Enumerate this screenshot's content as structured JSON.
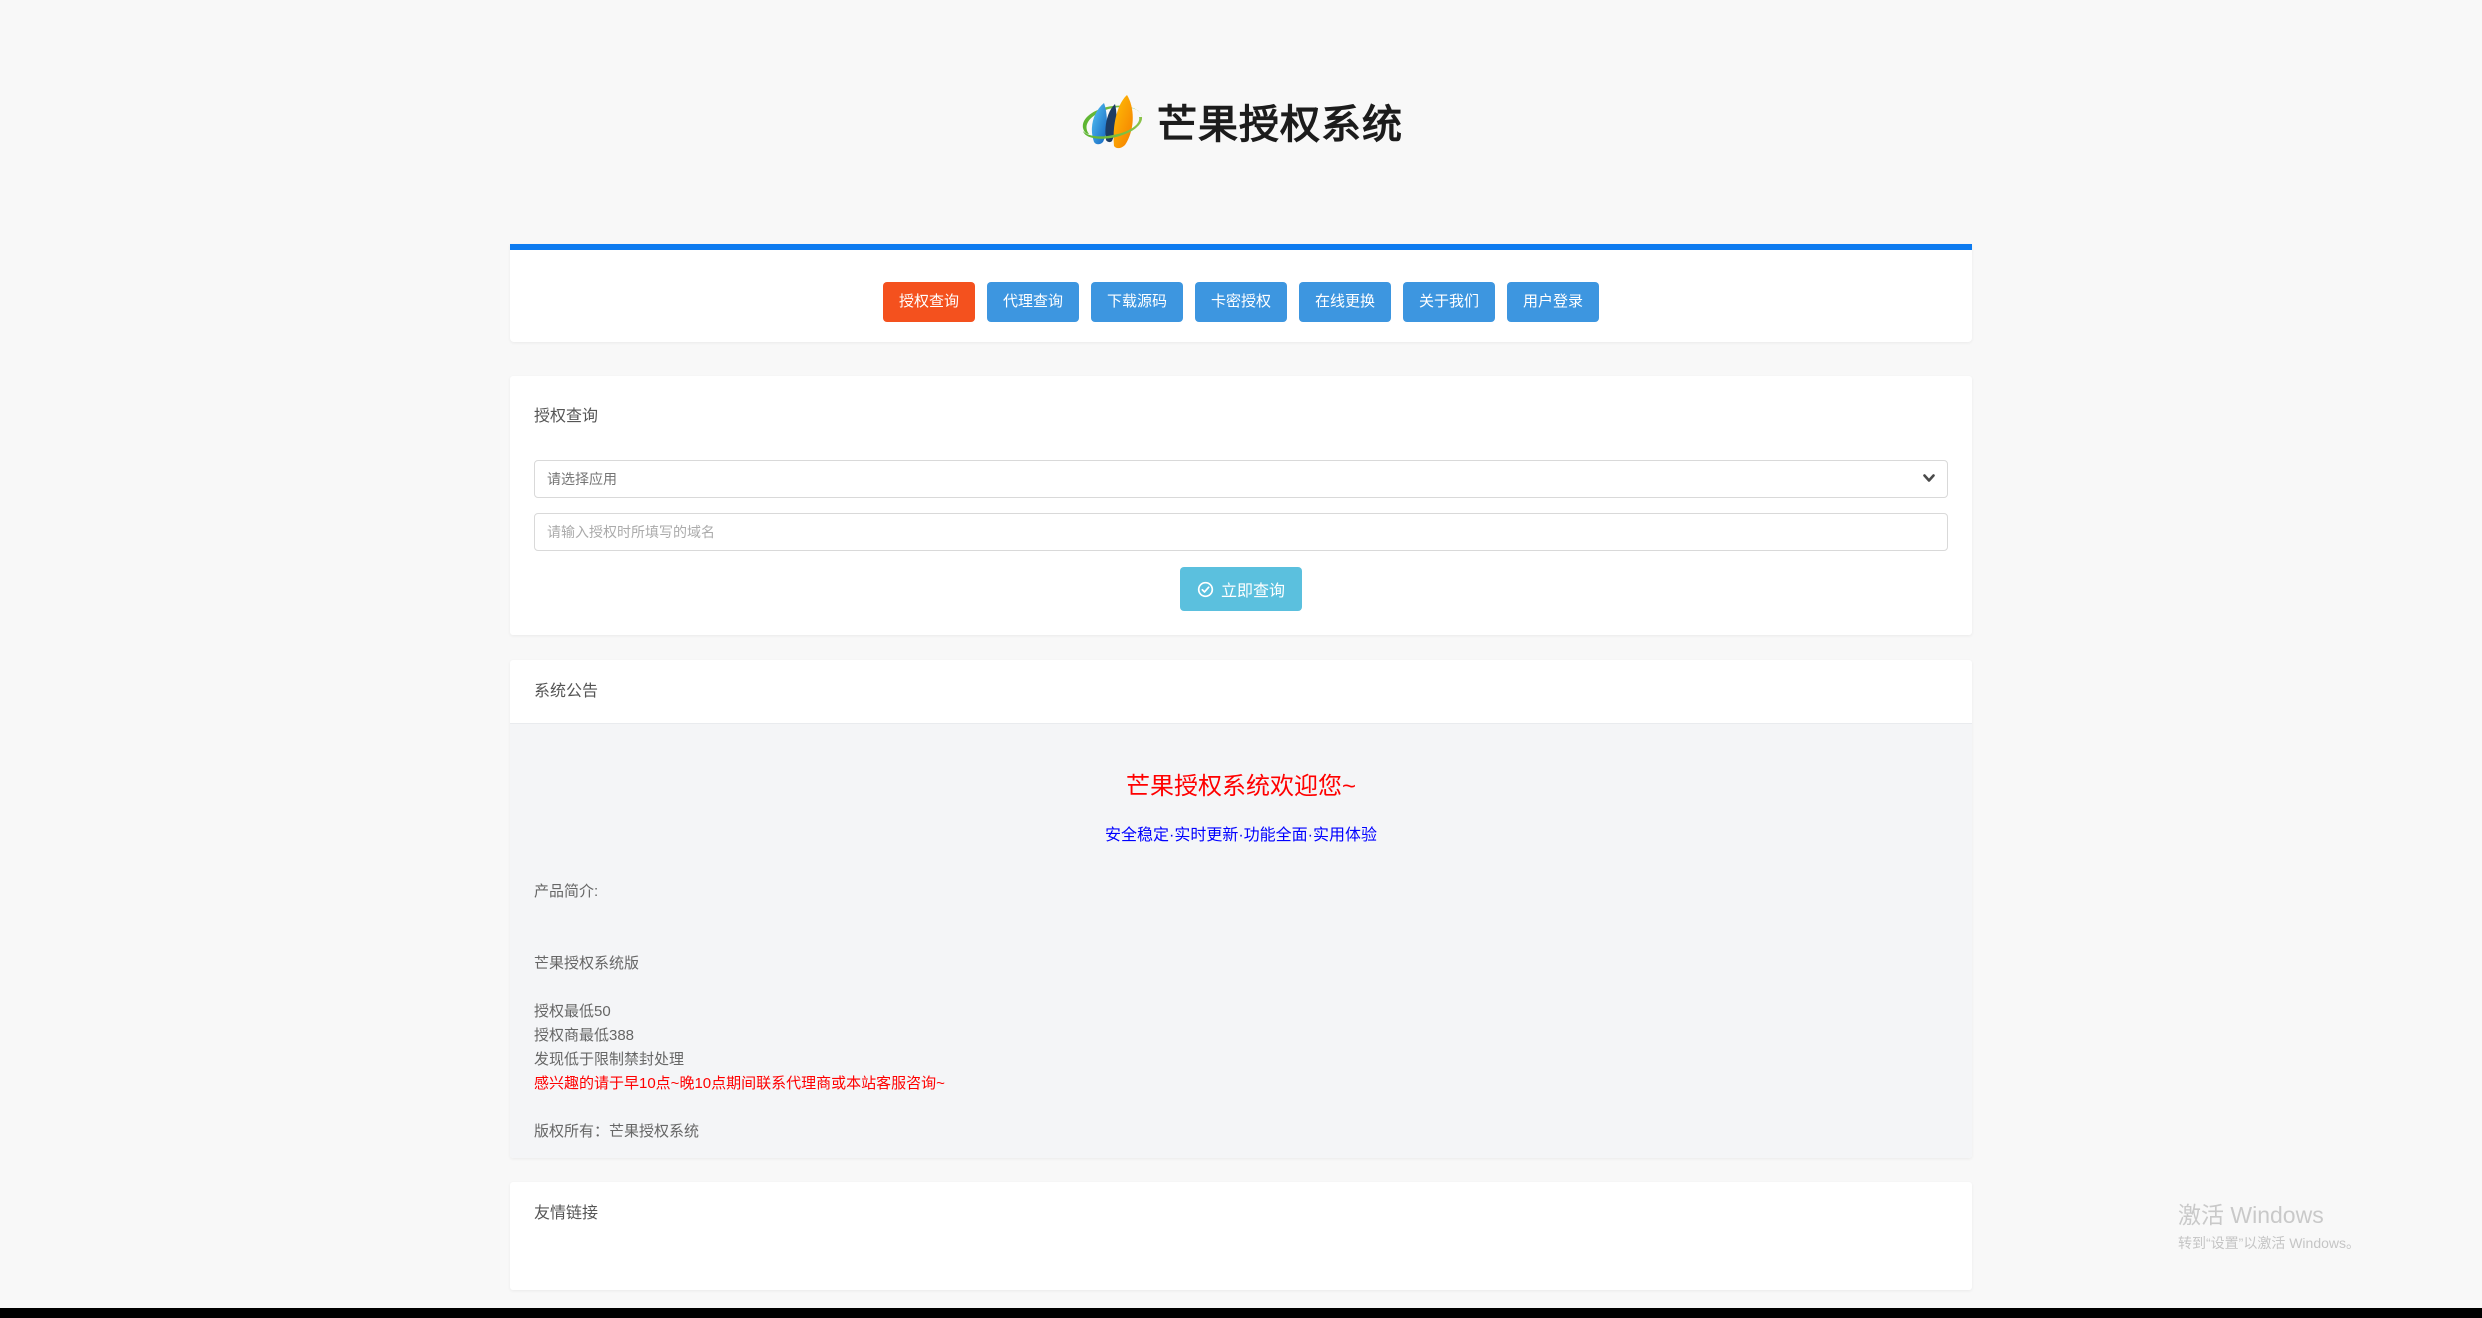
{
  "site": {
    "title": "芒果授权系统"
  },
  "nav": {
    "items": [
      {
        "label": "授权查询",
        "active": true
      },
      {
        "label": "代理查询",
        "active": false
      },
      {
        "label": "下载源码",
        "active": false
      },
      {
        "label": "卡密授权",
        "active": false
      },
      {
        "label": "在线更换",
        "active": false
      },
      {
        "label": "关于我们",
        "active": false
      },
      {
        "label": "用户登录",
        "active": false
      }
    ]
  },
  "query_card": {
    "title": "授权查询",
    "select_value": "请选择应用",
    "domain_placeholder": "请输入授权时所填写的域名",
    "submit_label": "立即查询"
  },
  "announcement": {
    "title": "系统公告",
    "welcome": "芒果授权系统欢迎您~",
    "tagline": "安全稳定·实时更新·功能全面·实用体验",
    "lines": [
      "产品简介:",
      "",
      "",
      "芒果授权系统版",
      "",
      "授权最低50",
      "授权商最低388",
      "发现低于限制禁封处理",
      "感兴趣的请于早10点~晚10点期间联系代理商或本站客服咨询~",
      "",
      "版权所有：芒果授权系统"
    ]
  },
  "links_card": {
    "title": "友情链接"
  },
  "watermark": {
    "line1": "激活 Windows",
    "line2": "转到“设置”以激活 Windows。"
  },
  "colors": {
    "accent_blue": "#0d7bf0",
    "nav_button_blue": "#3d96e0",
    "nav_button_active_orange": "#f4511e",
    "query_button_info": "#5bc0de",
    "announce_red": "#ff0000",
    "announce_blue": "#0000ff",
    "page_background": "#f8f8f8",
    "announce_panel_gray": "#f4f5f7"
  }
}
